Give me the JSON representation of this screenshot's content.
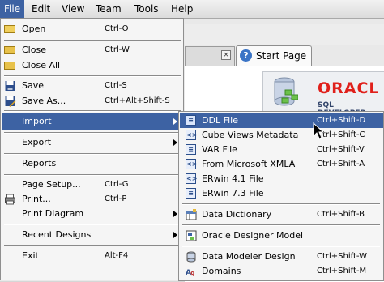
{
  "menubar": [
    {
      "label": "File",
      "active": true
    },
    {
      "label": "Edit",
      "active": false
    },
    {
      "label": "View",
      "active": false
    },
    {
      "label": "Team",
      "active": false
    },
    {
      "label": "Tools",
      "active": false
    },
    {
      "label": "Help",
      "active": false
    }
  ],
  "background": {
    "start_tab": "Start Page",
    "oracle_text": "ORACL",
    "sql_developer_text": "SQL DEVELOPER"
  },
  "file_menu": {
    "open": {
      "label": "Open",
      "accel": "Ctrl-O",
      "icon": "open-folder-icon"
    },
    "close": {
      "label": "Close",
      "accel": "Ctrl-W",
      "icon": "folder-icon"
    },
    "close_all": {
      "label": "Close All",
      "accel": "",
      "icon": "folder-icon"
    },
    "save": {
      "label": "Save",
      "accel": "Ctrl-S",
      "icon": "save-icon"
    },
    "save_as": {
      "label": "Save As...",
      "accel": "Ctrl+Alt+Shift-S",
      "icon": "save-as-icon"
    },
    "import": {
      "label": "Import",
      "accel": "",
      "icon": ""
    },
    "export": {
      "label": "Export",
      "accel": "",
      "icon": ""
    },
    "reports": {
      "label": "Reports",
      "accel": "",
      "icon": ""
    },
    "page_setup": {
      "label": "Page Setup...",
      "accel": "Ctrl-G",
      "icon": ""
    },
    "print": {
      "label": "Print...",
      "accel": "Ctrl-P",
      "icon": "printer-icon"
    },
    "print_diagram": {
      "label": "Print Diagram",
      "accel": "",
      "icon": ""
    },
    "recent_designs": {
      "label": "Recent Designs",
      "accel": "",
      "icon": ""
    },
    "exit": {
      "label": "Exit",
      "accel": "Alt-F4",
      "icon": ""
    }
  },
  "import_menu": {
    "ddl_file": {
      "label": "DDL File",
      "accel": "Ctrl+Shift-D"
    },
    "cube_views": {
      "label": "Cube Views Metadata",
      "accel": "Ctrl+Shift-C"
    },
    "var_file": {
      "label": "VAR File",
      "accel": "Ctrl+Shift-V"
    },
    "ms_xmla": {
      "label": "From Microsoft XMLA",
      "accel": "Ctrl+Shift-A"
    },
    "erwin41": {
      "label": "ERwin 4.1 File",
      "accel": ""
    },
    "erwin73": {
      "label": "ERwin 7.3 File",
      "accel": ""
    },
    "data_dictionary": {
      "label": "Data Dictionary",
      "accel": "Ctrl+Shift-B"
    },
    "oracle_designer": {
      "label": "Oracle Designer Model",
      "accel": ""
    },
    "data_modeler_design": {
      "label": "Data Modeler Design",
      "accel": "Ctrl+Shift-W"
    },
    "domains": {
      "label": "Domains",
      "accel": "Ctrl+Shift-M"
    }
  },
  "colors": {
    "highlight": "#3d62a3",
    "oracle_red": "#e0201b"
  }
}
